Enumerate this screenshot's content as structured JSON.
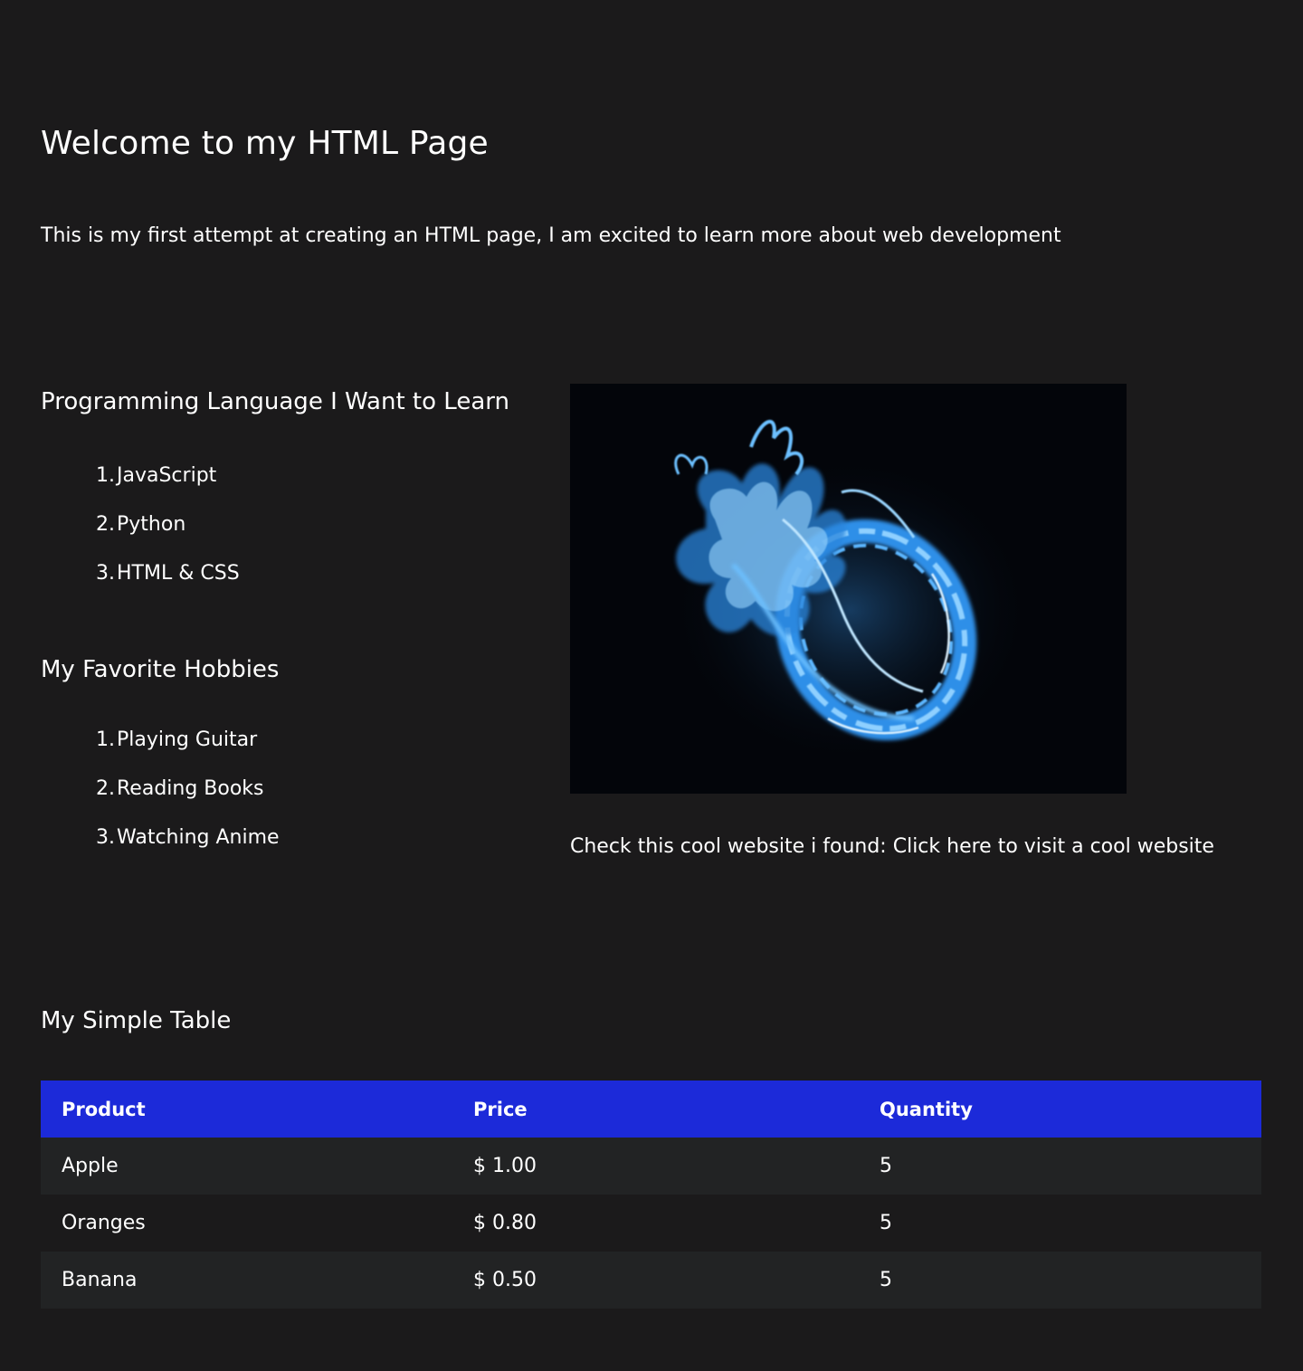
{
  "header": {
    "title": "Welcome to my HTML Page",
    "intro": "This is my first attempt at creating an HTML page,  I am excited to learn more about web development"
  },
  "languages": {
    "heading": "Programming Language I Want to Learn",
    "items": [
      {
        "num": "1.",
        "label": "JavaScript"
      },
      {
        "num": "2.",
        "label": "Python"
      },
      {
        "num": "3.",
        "label": "HTML & CSS"
      }
    ]
  },
  "hobbies": {
    "heading": "My Favorite Hobbies",
    "items": [
      {
        "num": "1.",
        "label": "Playing Guitar"
      },
      {
        "num": "2.",
        "label": "Reading Books"
      },
      {
        "num": "3.",
        "label": "Watching Anime"
      }
    ]
  },
  "image": {
    "subject": "blue-flame-ring"
  },
  "link": {
    "prefix": "Check this cool website i found: ",
    "text": "Click here to visit a cool website"
  },
  "table": {
    "heading": "My Simple Table",
    "columns": [
      "Product",
      "Price",
      "Quantity"
    ],
    "rows": [
      {
        "product": "Apple",
        "price": "$ 1.00",
        "quantity": "5"
      },
      {
        "product": "Oranges",
        "price": "$ 0.80",
        "quantity": "5"
      },
      {
        "product": "Banana",
        "price": "$ 0.50",
        "quantity": "5"
      }
    ]
  },
  "colors": {
    "background": "#1b1a1b",
    "table_header": "#1c2ad9",
    "row_alt": "#222324",
    "text": "#ffffff"
  }
}
